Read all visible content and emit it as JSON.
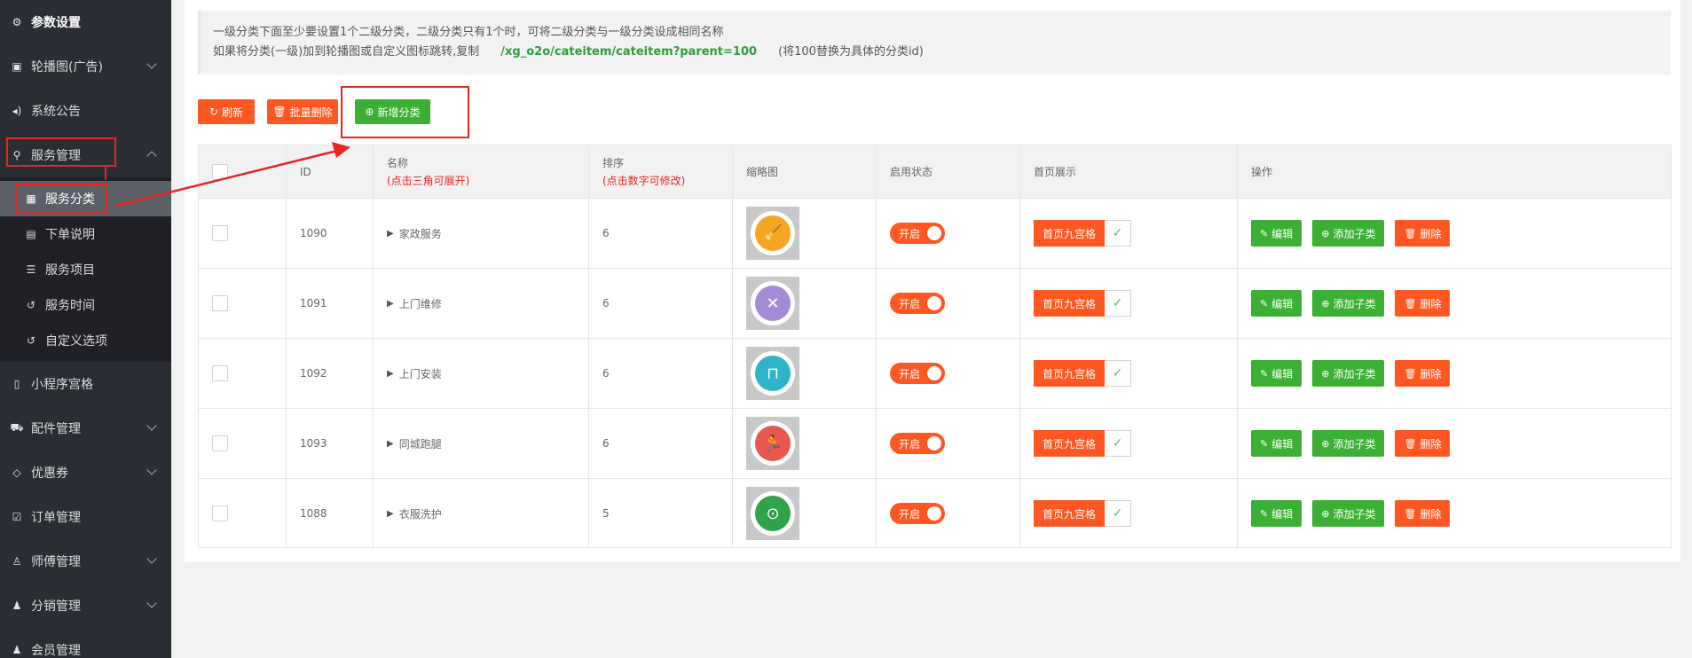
{
  "sidebar": {
    "items": [
      {
        "label": "参数设置",
        "icon": "gear-icon",
        "glyph": "⚙",
        "chevron": false
      },
      {
        "label": "轮播图(广告)",
        "icon": "image-icon",
        "glyph": "▣",
        "chevron": true
      },
      {
        "label": "系统公告",
        "icon": "speaker-icon",
        "glyph": "◂)",
        "chevron": false
      },
      {
        "label": "服务管理",
        "icon": "wrench-icon",
        "glyph": "⚲",
        "chevron": true,
        "expanded": true
      },
      {
        "label": "小程序宫格",
        "icon": "phone-icon",
        "glyph": "▯",
        "chevron": false
      },
      {
        "label": "配件管理",
        "icon": "cart-icon",
        "glyph": "⛟",
        "chevron": true
      },
      {
        "label": "优惠券",
        "icon": "diamond-icon",
        "glyph": "◇",
        "chevron": true
      },
      {
        "label": "订单管理",
        "icon": "check-square-icon",
        "glyph": "☑",
        "chevron": false
      },
      {
        "label": "师傅管理",
        "icon": "worker-icon",
        "glyph": "♙",
        "chevron": true
      },
      {
        "label": "分销管理",
        "icon": "user-plus-icon",
        "glyph": "♟",
        "chevron": true
      },
      {
        "label": "会员管理",
        "icon": "user-icon",
        "glyph": "♟",
        "chevron": false
      }
    ],
    "sub_items": [
      {
        "label": "服务分类",
        "icon": "grid-icon",
        "glyph": "▦",
        "active": true
      },
      {
        "label": "下单说明",
        "icon": "file-icon",
        "glyph": "▤",
        "active": false
      },
      {
        "label": "服务项目",
        "icon": "list-icon",
        "glyph": "☰",
        "active": false
      },
      {
        "label": "服务时间",
        "icon": "history-icon",
        "glyph": "↺",
        "active": false
      },
      {
        "label": "自定义选项",
        "icon": "history-icon",
        "glyph": "↺",
        "active": false
      }
    ]
  },
  "notice": {
    "line1": "一级分类下面至少要设置1个二级分类，二级分类只有1个时，可将二级分类与一级分类设成相同名称",
    "line2_prefix": "如果将分类(一级)加到轮播图或自定义图标跳转,复制",
    "line2_path": "/xg_o2o/cateitem/cateitem?parent=100",
    "line2_suffix": "(将100替换为具体的分类id)"
  },
  "toolbar": {
    "refresh_label": "刷新",
    "batch_delete_label": "批量删除",
    "add_category_label": "新增分类"
  },
  "table": {
    "headers": {
      "id": "ID",
      "name": "名称",
      "name_hint": "(点击三角可展开)",
      "sort": "排序",
      "sort_hint": "(点击数字可修改)",
      "thumb": "缩略图",
      "status": "启用状态",
      "home": "首页展示",
      "ops": "操作"
    },
    "rows": [
      {
        "id": "1090",
        "name": "家政服务",
        "sort": "6",
        "status": "开启",
        "home": "首页九宫格",
        "thumb_color": "#f5a623",
        "thumb_icon": "broom-icon",
        "glyph": "🧹"
      },
      {
        "id": "1091",
        "name": "上门维修",
        "sort": "6",
        "status": "开启",
        "home": "首页九宫格",
        "thumb_color": "#a58ad6",
        "thumb_icon": "tools-icon",
        "glyph": "✕"
      },
      {
        "id": "1092",
        "name": "上门安装",
        "sort": "6",
        "status": "开启",
        "home": "首页九宫格",
        "thumb_color": "#2fb3c8",
        "thumb_icon": "install-icon",
        "glyph": "⊓"
      },
      {
        "id": "1093",
        "name": "同城跑腿",
        "sort": "6",
        "status": "开启",
        "home": "首页九宫格",
        "thumb_color": "#e8584e",
        "thumb_icon": "runner-icon",
        "glyph": "🏃"
      },
      {
        "id": "1088",
        "name": "衣服洗护",
        "sort": "5",
        "status": "开启",
        "home": "首页九宫格",
        "thumb_color": "#2ea34a",
        "thumb_icon": "washer-icon",
        "glyph": "⊙"
      }
    ],
    "actions": {
      "edit_label": "编辑",
      "add_child_label": "添加子类",
      "delete_label": "删除"
    }
  },
  "colors": {
    "sidebar_bg": "#2a2d33",
    "accent_orange": "#ff5722",
    "accent_green": "#3cb035",
    "highlight_red": "#e82424"
  }
}
